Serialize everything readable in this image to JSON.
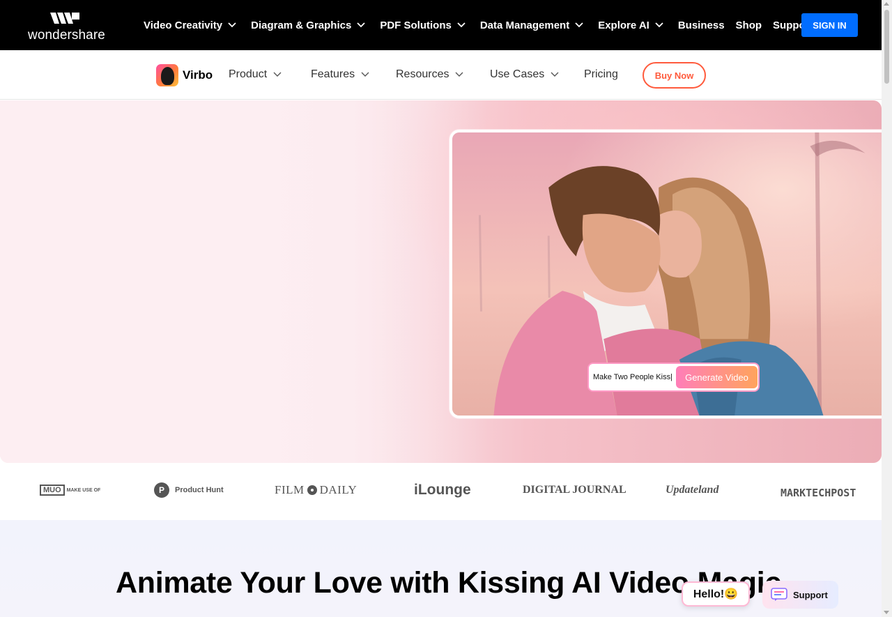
{
  "brand": {
    "logo_text": "wondershare",
    "product_name": "Virbo"
  },
  "topnav": {
    "items": [
      {
        "label": "Video Creativity",
        "dropdown": true
      },
      {
        "label": "Diagram & Graphics",
        "dropdown": true
      },
      {
        "label": "PDF Solutions",
        "dropdown": true
      },
      {
        "label": "Data Management",
        "dropdown": true
      },
      {
        "label": "Explore AI",
        "dropdown": true
      },
      {
        "label": "Business",
        "dropdown": false
      },
      {
        "label": "Shop",
        "dropdown": false
      },
      {
        "label": "Support",
        "dropdown": false
      }
    ],
    "signin_label": "SIGN IN"
  },
  "subnav": {
    "items": [
      {
        "label": "Product"
      },
      {
        "label": "Features"
      },
      {
        "label": "Resources"
      },
      {
        "label": "Use Cases"
      },
      {
        "label": "Pricing"
      }
    ],
    "buy_label": "Buy Now"
  },
  "hero": {
    "prompt_text": "Make Two People Kiss|",
    "generate_label": "Generate Video"
  },
  "press_logos": {
    "muo_box": "MUO",
    "muo_small": "MAKE USE OF",
    "product_hunt_letter": "P",
    "product_hunt": "Product Hunt",
    "film_daily_1": "FILM",
    "film_daily_2": "DAILY",
    "ilounge": "iLounge",
    "digital_journal": "DIGITAL JOURNAL",
    "updateland": "Updateland",
    "marktechpost": "MARKTECHPOST"
  },
  "section": {
    "title": "Animate Your Love with Kissing AI Video Magic"
  },
  "widgets": {
    "hello": "Hello!😀",
    "support": "Support"
  },
  "colors": {
    "topbar_bg": "#000000",
    "signin_bg": "#006dff",
    "buy_accent": "#ff5a3c",
    "generate_gradient_start": "#ff7eb9",
    "generate_gradient_end": "#ffa45c"
  }
}
